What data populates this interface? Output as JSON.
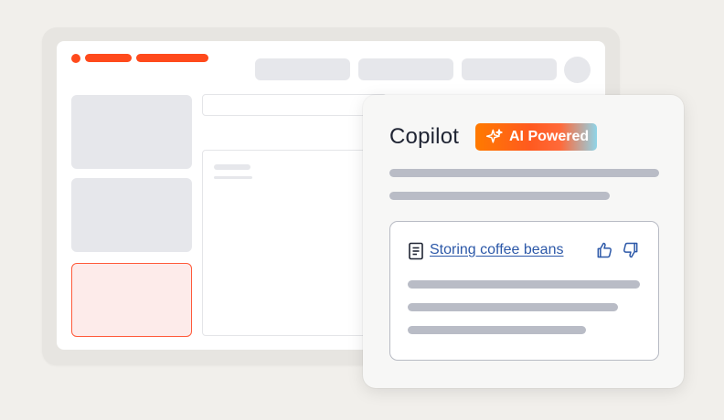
{
  "app": {
    "nav": {
      "pill_count": 3
    }
  },
  "copilot": {
    "title": "Copilot",
    "badge": {
      "label": "AI Powered",
      "icon": "sparkle-icon"
    },
    "result": {
      "icon": "document-icon",
      "link_label": "Storing coffee beans",
      "feedback": {
        "up_icon": "thumbs-up-icon",
        "down_icon": "thumbs-down-icon"
      }
    }
  },
  "colors": {
    "brand": "#ff4a1c",
    "link": "#2c58a8",
    "placeholder": "#b9bcc6",
    "selected_card": "#fdebea"
  }
}
